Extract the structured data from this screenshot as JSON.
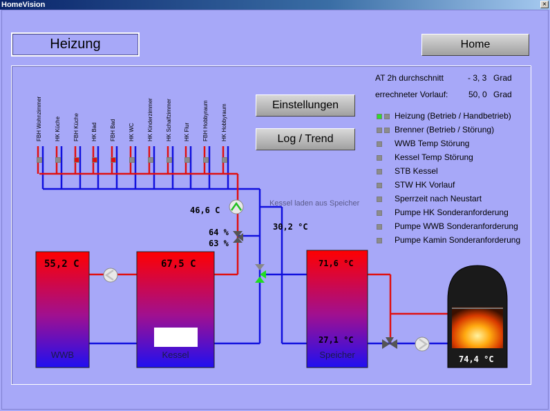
{
  "window": {
    "title": "HomeVision",
    "close_glyph": "×"
  },
  "header": {
    "title": "Heizung",
    "home_button": "Home"
  },
  "buttons": {
    "settings": "Einstellungen",
    "log": "Log / Trend"
  },
  "info": {
    "avg_label": "AT 2h durchschnitt",
    "avg_value": "- 3, 3",
    "avg_unit": "Grad",
    "flow_label": "errechneter Vorlauf:",
    "flow_value": "50, 0",
    "flow_unit": "Grad"
  },
  "legend": [
    {
      "label": "Heizung (Betrieb / Handbetrieb)",
      "leds": [
        "#2edc2e",
        "#8c8c8c"
      ]
    },
    {
      "label": "Brenner (Betrieb / Störung)",
      "leds": [
        "#8c8c8c",
        "#8c8c8c"
      ]
    },
    {
      "label": "WWB Temp Störung",
      "leds": [
        "#8c8c8c"
      ]
    },
    {
      "label": "Kessel Temp Störung",
      "leds": [
        "#8c8c8c"
      ]
    },
    {
      "label": "STB Kessel",
      "leds": [
        "#8c8c8c"
      ]
    },
    {
      "label": "STW HK Vorlauf",
      "leds": [
        "#8c8c8c"
      ]
    },
    {
      "label": "Sperrzeit nach Neustart",
      "leds": [
        "#8c8c8c"
      ]
    },
    {
      "label": "Pumpe HK Sonderanforderung",
      "leds": [
        "#8c8c8c"
      ]
    },
    {
      "label": "Pumpe WWB Sonderanforderung",
      "leds": [
        "#8c8c8c"
      ]
    },
    {
      "label": "Pumpe Kamin Sonderanforderung",
      "leds": [
        "#8c8c8c"
      ]
    }
  ],
  "circuits": [
    {
      "label": "FBH Wohnzimmer",
      "state": "#8c8c8c"
    },
    {
      "label": "HK Küche",
      "state": "#8c8c8c"
    },
    {
      "label": "FBH Küche",
      "state": "#e01010"
    },
    {
      "label": "HK Bad",
      "state": "#e01010"
    },
    {
      "label": "FBH Bad",
      "state": "#e01010"
    },
    {
      "label": "HK WC",
      "state": "#8c8c8c"
    },
    {
      "label": "HK Kinderzimmer",
      "state": "#8c8c8c"
    },
    {
      "label": "HK Schalfzimmer",
      "state": "#8c8c8c"
    },
    {
      "label": "HK Flur",
      "state": "#8c8c8c"
    },
    {
      "label": "FBH Hobbyraum",
      "state": "#8c8c8c"
    },
    {
      "label": "HK Hobbyraum",
      "state": "#8c8c8c"
    }
  ],
  "readings": {
    "flow_temp": "46,6  C",
    "mix_valve_1": "64  %",
    "mix_valve_2": "63  %",
    "return_temp": "30,2 °C",
    "charge_note": "Kessel laden aus Speicher"
  },
  "tanks": {
    "wwb": {
      "temp": "55,2  C",
      "label": "WWB"
    },
    "kessel": {
      "temp": "67,5  C",
      "label": "Kessel"
    },
    "speicher": {
      "top_temp": "71,6 °C",
      "bottom_temp": "27,1 °C",
      "label": "Speicher"
    },
    "kamin": {
      "temp": "74,4 °C"
    }
  },
  "colors": {
    "hot": "#e01010",
    "cold": "#1010e0",
    "pipe_red": "#e01010",
    "pipe_blue": "#1010dd"
  }
}
